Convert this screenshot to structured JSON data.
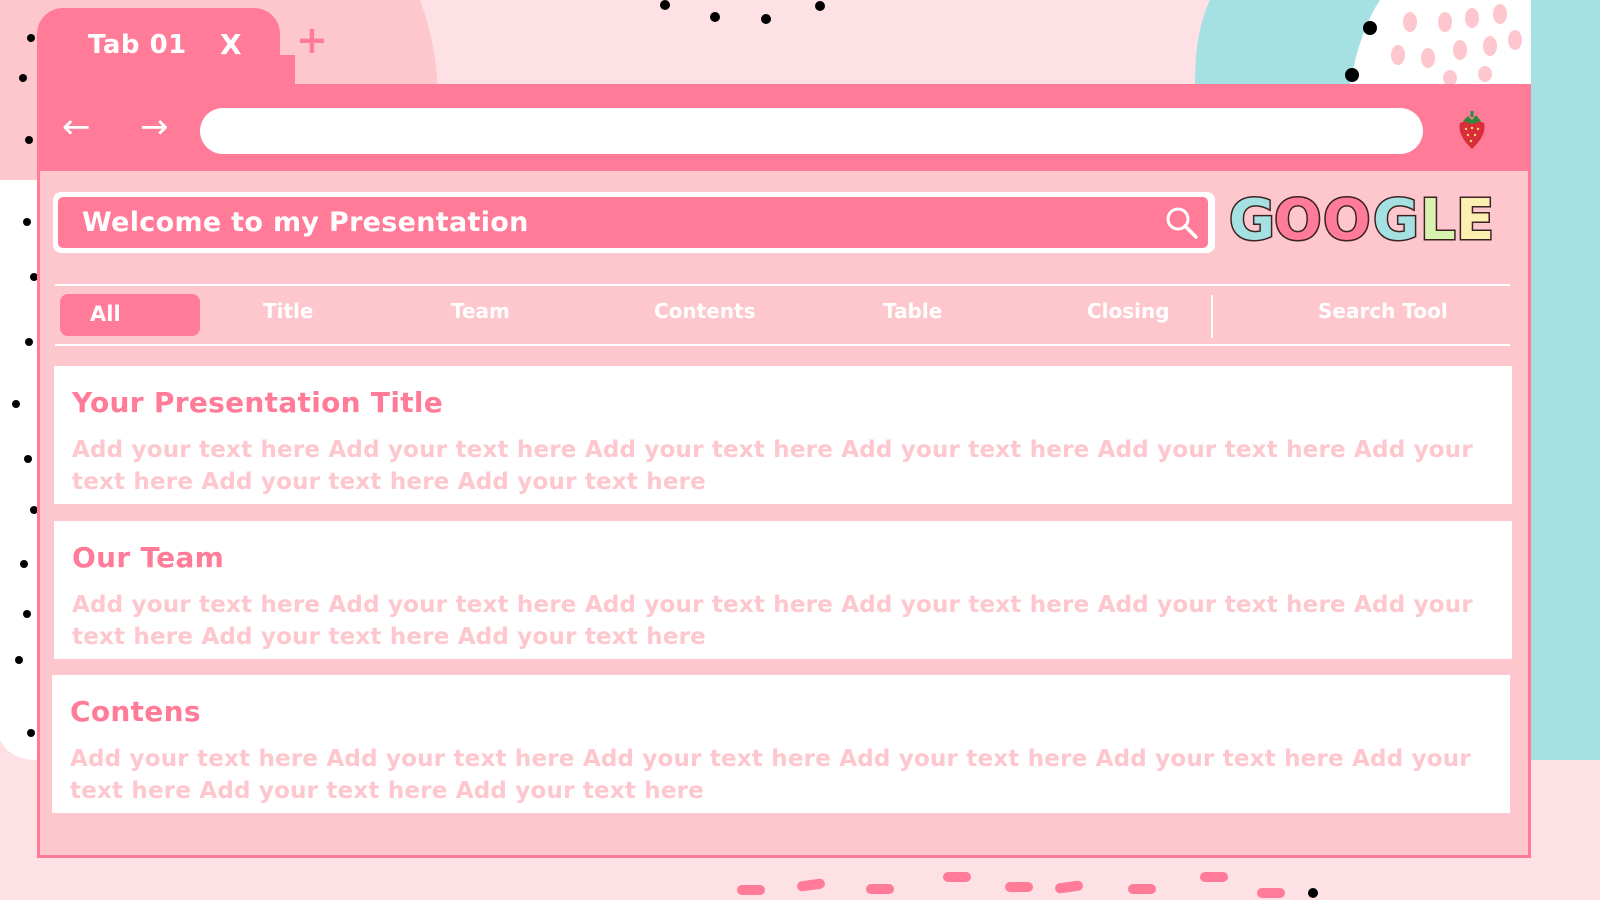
{
  "tab": {
    "title": "Tab 01",
    "close_label": "X",
    "new_tab_label": "+"
  },
  "toolbar": {
    "back_icon": "arrow-left-icon",
    "forward_icon": "arrow-right-icon",
    "address_value": "",
    "profile_icon": "strawberry-icon"
  },
  "search": {
    "query": "Welcome to my Presentation",
    "icon": "search-icon"
  },
  "logo": {
    "letters": [
      "G",
      "O",
      "O",
      "G",
      "L",
      "E"
    ]
  },
  "categories": [
    "All",
    "Title",
    "Team",
    "Contents",
    "Table",
    "Closing",
    "Search Tool"
  ],
  "active_category": "All",
  "results": [
    {
      "title": "Your Presentation Title",
      "body": "Add your text here Add your text here Add your text here Add your text here Add your text here Add your text here Add your text here Add your text here"
    },
    {
      "title": "Our Team",
      "body": "Add your text here Add your text here Add your text here Add your text here Add your text here Add your text here Add your text here Add your text here"
    },
    {
      "title": "Contens",
      "body": "Add your text here Add your text here Add your text here Add your text here Add your text here Add your text here Add your text here Add your text here"
    }
  ],
  "colors": {
    "accent": "#ff7b98",
    "panel": "#fdc7cd",
    "background_pink": "#fde1e4",
    "teal": "#a5e1e2",
    "dot": "#000000"
  }
}
